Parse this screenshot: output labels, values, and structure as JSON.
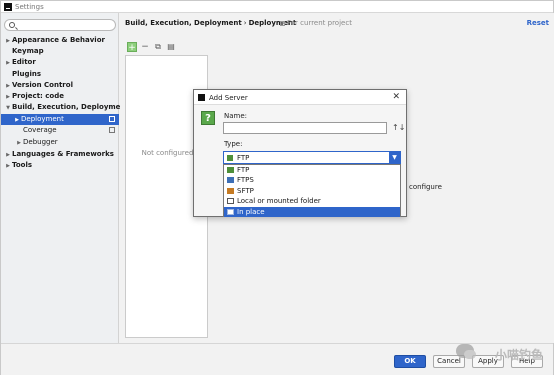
{
  "window": {
    "title": "Settings"
  },
  "sidebar": {
    "items": [
      {
        "label": "Appearance & Behavior",
        "arrow": "▶"
      },
      {
        "label": "Keymap",
        "arrow": ""
      },
      {
        "label": "Editor",
        "arrow": "▶"
      },
      {
        "label": "Plugins",
        "arrow": ""
      },
      {
        "label": "Version Control",
        "arrow": "▶"
      },
      {
        "label": "Project: code",
        "arrow": "▶"
      },
      {
        "label": "Build, Execution, Deployment",
        "arrow": "▼"
      },
      {
        "label": "Deployment",
        "arrow": "▶"
      },
      {
        "label": "Coverage",
        "arrow": ""
      },
      {
        "label": "Debugger",
        "arrow": "▶"
      },
      {
        "label": "Languages & Frameworks",
        "arrow": "▶"
      },
      {
        "label": "Tools",
        "arrow": "▶"
      }
    ]
  },
  "header": {
    "breadcrumb": [
      "Build, Execution, Deployment",
      "Deployment"
    ],
    "separator": "›",
    "scope_label": "For current project",
    "reset_label": "Reset"
  },
  "toolbar": {
    "add": "+",
    "remove": "−",
    "copy": "⧉",
    "delete": "▤"
  },
  "main": {
    "not_configured": "Not configured",
    "configure_hint": "configure"
  },
  "dialog": {
    "title": "Add Server",
    "close": "✕",
    "help": "?",
    "name_label": "Name:",
    "name_value": "",
    "sort_icon": "↑↓",
    "type_label": "Type:",
    "type_selected": "FTP",
    "dropdown_arrow": "▼",
    "options": [
      "FTP",
      "FTPS",
      "SFTP",
      "Local or mounted folder",
      "In place"
    ],
    "highlighted_option": "In place"
  },
  "buttons": {
    "ok": "OK",
    "cancel": "Cancel",
    "apply": "Apply",
    "help": "Help"
  },
  "watermark": "小喵钓鱼"
}
